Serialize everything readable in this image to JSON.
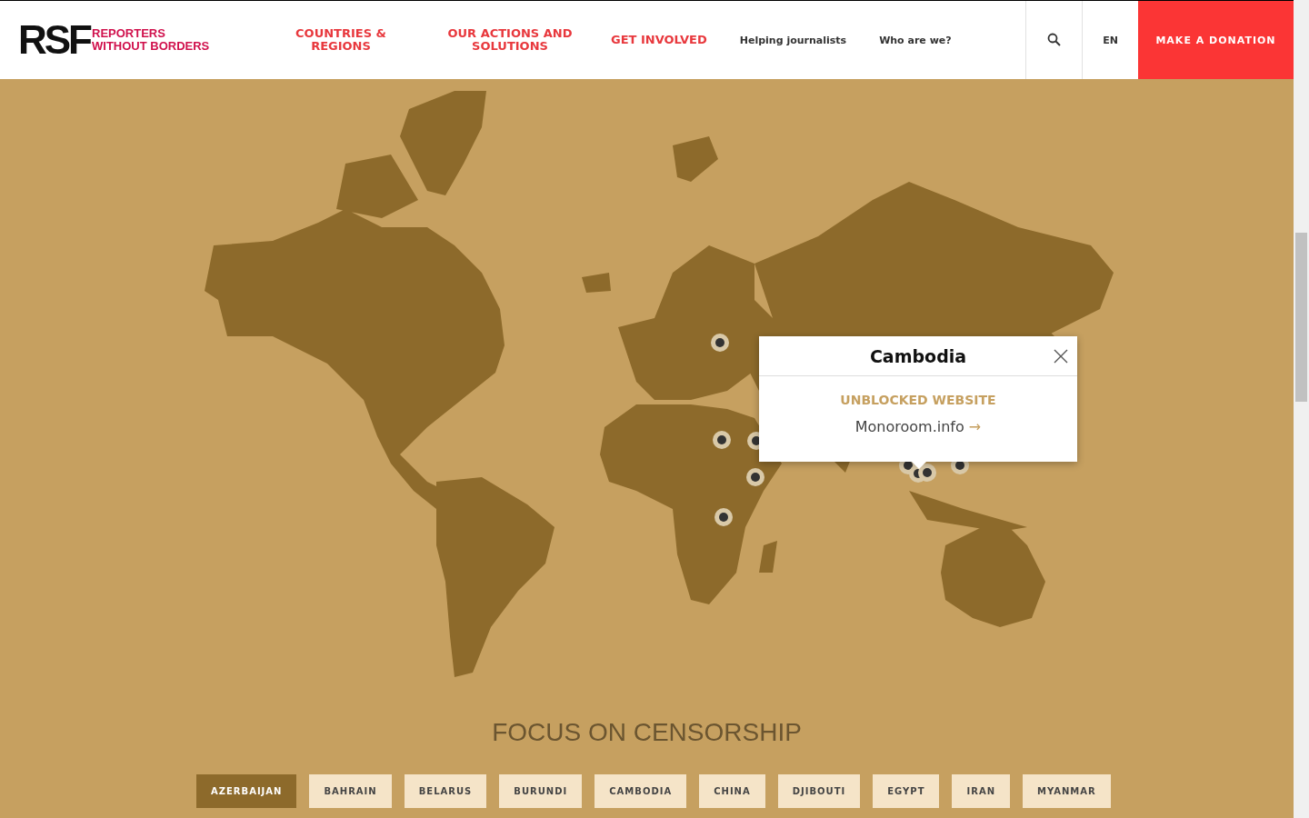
{
  "header": {
    "logo_mark": "RSF",
    "logo_text": [
      "REPORTERS",
      "WITHOUT BORDERS"
    ],
    "main_nav": [
      "COUNTRIES & REGIONS",
      "OUR ACTIONS AND SOLUTIONS",
      "GET INVOLVED"
    ],
    "secondary_nav": [
      "Helping journalists",
      "Who are we?"
    ],
    "language": "EN",
    "donate_button": "MAKE A DONATION"
  },
  "popup": {
    "title": "Cambodia",
    "category": "UNBLOCKED WEBSITE",
    "link": "Monoroom.info",
    "link_arrow": "→"
  },
  "section_title": "FOCUS ON CENSORSHIP",
  "countries": [
    {
      "label": "AZERBAIJAN",
      "selected": true
    },
    {
      "label": "BAHRAIN",
      "selected": false
    },
    {
      "label": "BELARUS",
      "selected": false
    },
    {
      "label": "BURUNDI",
      "selected": false
    },
    {
      "label": "CAMBODIA",
      "selected": false
    },
    {
      "label": "CHINA",
      "selected": false
    },
    {
      "label": "DJIBOUTI",
      "selected": false
    },
    {
      "label": "EGYPT",
      "selected": false
    },
    {
      "label": "IRAN",
      "selected": false
    },
    {
      "label": "MYANMAR",
      "selected": false
    }
  ]
}
